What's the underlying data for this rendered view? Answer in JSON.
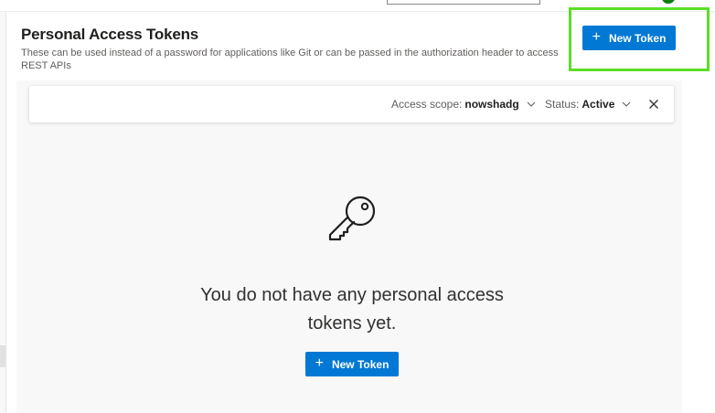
{
  "header": {
    "title": "Personal Access Tokens",
    "description": "These can be used instead of a password for applications like Git or can be passed in the authorization header to access REST APIs",
    "new_token_label": "New Token",
    "plus_glyph": "+"
  },
  "filters": {
    "scope_label": "Access scope:",
    "scope_value": "nowshadg",
    "status_label": "Status:",
    "status_value": "Active"
  },
  "empty_state": {
    "icon": "key-icon",
    "message": "You do not have any personal access tokens yet.",
    "button_label": "New Token",
    "plus_glyph": "+"
  },
  "colors": {
    "primary": "#0078d4",
    "highlight": "#5bde27",
    "content_background": "#f8f8f8"
  }
}
